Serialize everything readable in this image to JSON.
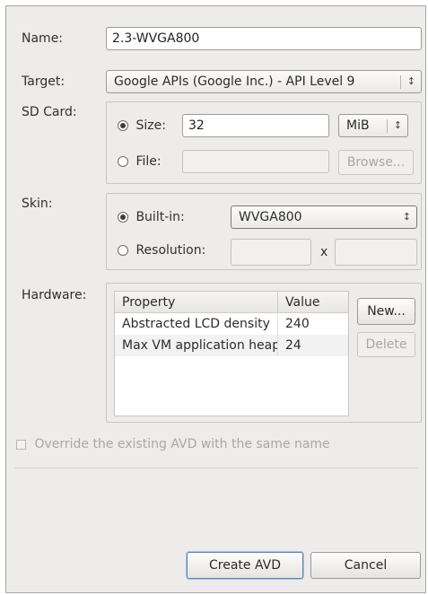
{
  "form": {
    "name_label": "Name:",
    "name_value": "2.3-WVGA800",
    "target_label": "Target:",
    "target_value": "Google APIs (Google Inc.) - API Level 9",
    "sdcard_label": "SD Card:",
    "size_label": "Size:",
    "size_value": "32",
    "size_unit": "MiB",
    "file_label": "File:",
    "file_value": "",
    "browse_label": "Browse...",
    "skin_label": "Skin:",
    "builtin_label": "Built-in:",
    "builtin_value": "WVGA800",
    "resolution_label": "Resolution:",
    "resolution_x": "x",
    "hardware_label": "Hardware:",
    "override_label": "Override the existing AVD with the same name"
  },
  "hardware": {
    "columns": [
      "Property",
      "Value"
    ],
    "rows": [
      {
        "property": "Abstracted LCD density",
        "value": "240"
      },
      {
        "property": "Max VM application heap size",
        "value": "24"
      }
    ],
    "new_label": "New...",
    "delete_label": "Delete"
  },
  "footer": {
    "create_label": "Create AVD",
    "cancel_label": "Cancel"
  },
  "icons": {
    "combo_arrow": "up-down-chevron-icon"
  }
}
